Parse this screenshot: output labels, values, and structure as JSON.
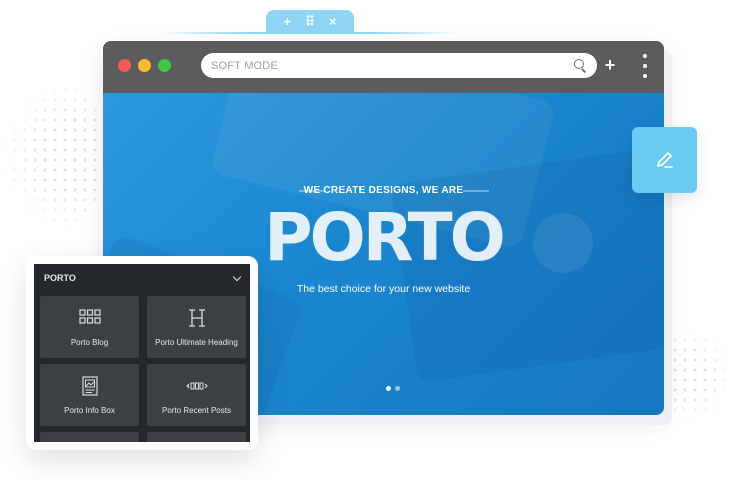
{
  "top_tab": {
    "plus_icon": "+",
    "move_icon": "⠿",
    "close_icon": "×"
  },
  "browser": {
    "address_bar": {
      "placeholder": "SOFT MODE"
    },
    "new_tab_glyph": "+",
    "traffic_lights": {
      "close": "#f35b56",
      "minimize": "#fbbc2e",
      "maximize": "#3dc84a"
    }
  },
  "hero": {
    "tagline": "WE CREATE DESIGNS, WE ARE",
    "brand": "PORTO",
    "subline": "The best choice for your new website",
    "slides": {
      "total": 2,
      "active": 1
    },
    "accent_color": "#1a87d0"
  },
  "edit_button": {
    "icon": "pencil-icon",
    "color": "#69cdf3"
  },
  "widget_panel": {
    "title": "PORTO",
    "widgets": [
      {
        "label": "Porto Blog",
        "icon": "blog-grid-icon"
      },
      {
        "label": "Porto Ultimate Heading",
        "icon": "heading-icon"
      },
      {
        "label": "Porto Info Box",
        "icon": "info-box-icon"
      },
      {
        "label": "Porto Recent Posts",
        "icon": "recent-posts-icon"
      }
    ]
  }
}
